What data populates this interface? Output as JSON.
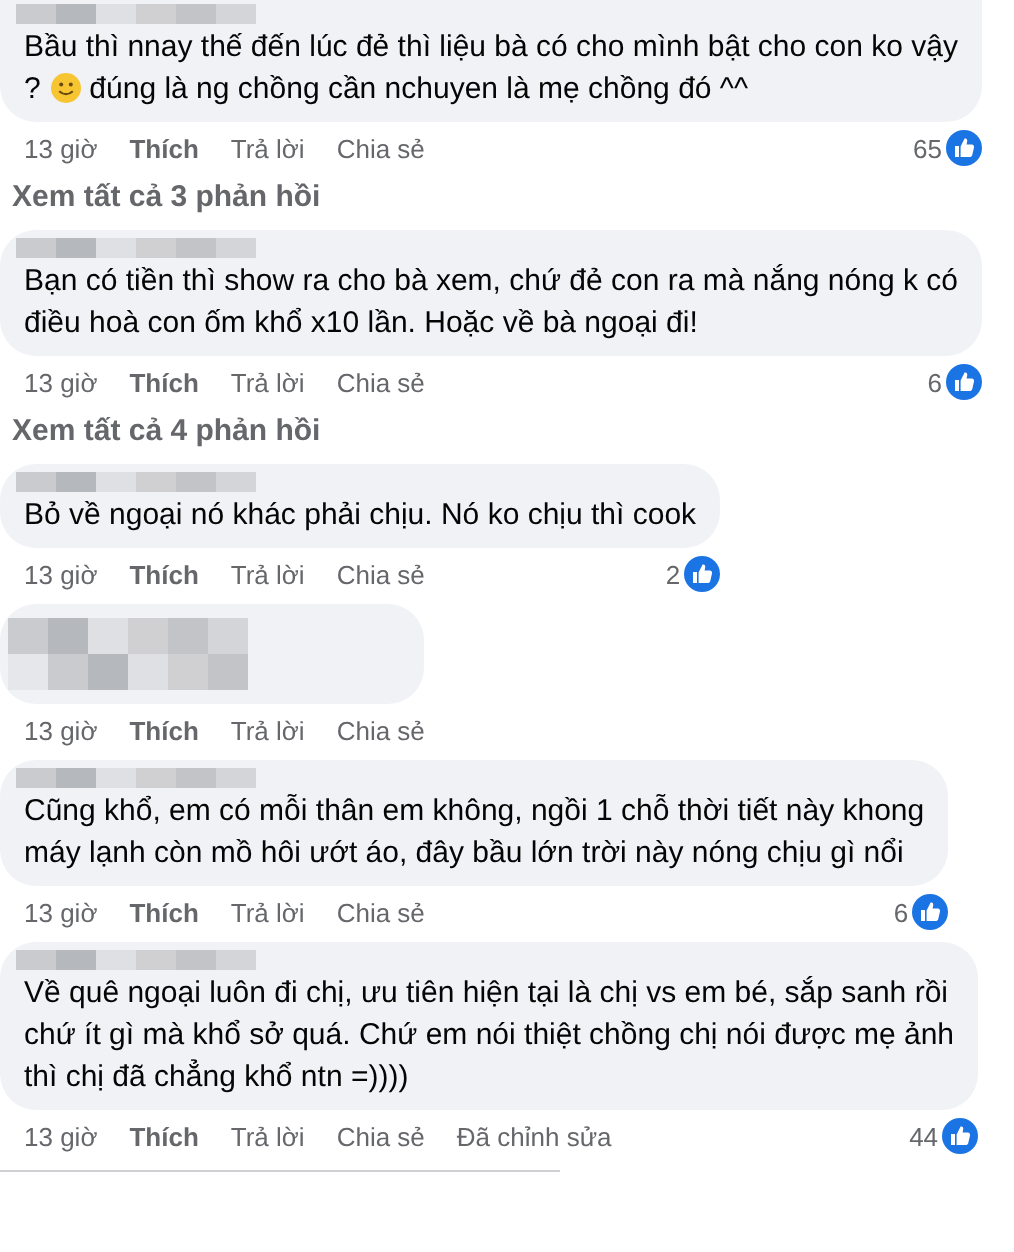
{
  "items": [
    {
      "kind": "comment",
      "lines": [
        [
          {
            "kind": "text",
            "text": "Bầu thì nnay thế đến lúc đẻ thì liệu bà có cho mình bật cho con ko vậy"
          }
        ],
        [
          {
            "kind": "text",
            "text": "? "
          },
          {
            "kind": "emoji"
          },
          {
            "kind": "text",
            "text": " đúng là ng chồng cần nchuyen là mẹ chồng đó ^^"
          }
        ]
      ],
      "time": "13 giờ",
      "actions": [
        "Thích",
        "Trả lời",
        "Chia sẻ"
      ],
      "reactions": "65"
    },
    {
      "kind": "replies_link",
      "text": "Xem tất cả 3 phản hồi"
    },
    {
      "kind": "comment",
      "lines": [
        [
          {
            "kind": "text",
            "text": "Bạn có tiền thì show ra cho bà xem, chứ đẻ con ra mà nắng nóng k có"
          }
        ],
        [
          {
            "kind": "text",
            "text": "điều hoà con ốm khổ x10 lần. Hoặc về bà ngoại đi!"
          }
        ]
      ],
      "time": "13 giờ",
      "actions": [
        "Thích",
        "Trả lời",
        "Chia sẻ"
      ],
      "reactions": "6"
    },
    {
      "kind": "replies_link",
      "text": "Xem tất cả 4 phản hồi"
    },
    {
      "kind": "comment",
      "lines": [
        [
          {
            "kind": "text",
            "text": "Bỏ về ngoại nó khác phải chịu. Nó ko chịu thì cook"
          }
        ]
      ],
      "time": "13 giờ",
      "actions": [
        "Thích",
        "Trả lời",
        "Chia sẻ"
      ],
      "reactions": "2"
    },
    {
      "kind": "blurred_comment",
      "time": "13 giờ",
      "actions": [
        "Thích",
        "Trả lời",
        "Chia sẻ"
      ]
    },
    {
      "kind": "comment",
      "lines": [
        [
          {
            "kind": "text",
            "text": "Cũng khổ, em có mỗi thân em không, ngồi 1 chỗ thời tiết này khong"
          }
        ],
        [
          {
            "kind": "text",
            "text": "máy lạnh còn mồ hôi ướt áo, đây bầu lớn trời này nóng chịu gì nổi"
          }
        ]
      ],
      "time": "13 giờ",
      "actions": [
        "Thích",
        "Trả lời",
        "Chia sẻ"
      ],
      "reactions": "6"
    },
    {
      "kind": "comment",
      "lines": [
        [
          {
            "kind": "text",
            "text": "Về quê ngoại luôn đi chị, ưu tiên hiện tại là chị vs em bé, sắp sanh rồi"
          }
        ],
        [
          {
            "kind": "text",
            "text": "chứ ít gì mà khổ sở quá. Chứ em nói thiệt chồng chị nói được mẹ ảnh"
          }
        ],
        [
          {
            "kind": "text",
            "text": "thì chị đã chẳng khổ ntn =))))"
          }
        ]
      ],
      "time": "13 giờ",
      "actions": [
        "Thích",
        "Trả lời",
        "Chia sẻ"
      ],
      "edited": "Đã chỉnh sửa",
      "reactions": "44"
    }
  ]
}
